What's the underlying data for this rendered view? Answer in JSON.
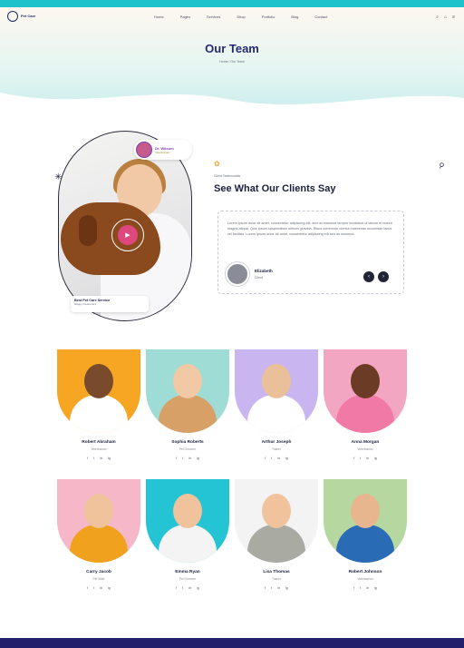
{
  "topbar": {
    "items": [
      "",
      "",
      "",
      "",
      "",
      "",
      ""
    ]
  },
  "header": {
    "logo_text": "Pet\nCare",
    "menu": [
      "Home",
      "Pages",
      "Services",
      "Shop",
      "Portfolio",
      "Blog",
      "Contact"
    ],
    "title": "Our Team",
    "breadcrumb": "Home / Our Team"
  },
  "hero_photo": {
    "doctor_name": "Dr. Wilsom",
    "doctor_role": "Veterinarian",
    "care_title": "Best Pet Care Service",
    "care_sub": "Happy Customers"
  },
  "testimonial": {
    "kicker": "Client Testimonials",
    "title": "See What Our Clients Say",
    "quote": "Lorem ipsum dolor sit amet, consectetur adipiscing elit, sed do eiusmod tempor incididunt ut labore et dolore magna aliqua. Quis ipsum suspendisse ultrices gravida. Risus commodo viverra maecenas accumsan lacus vel facilisis. Lorem ipsum dolor sit amet, consectetur adipiscing elit sed do eiusmod.",
    "author_name": "Elizabeth",
    "author_role": "Client",
    "prev": "‹",
    "next": "›"
  },
  "team": [
    {
      "name": "Robert Abraham",
      "role": "Veterinarian",
      "bg": "#f6a623",
      "skin": "#7a4a2c",
      "shirt": "#ffffff"
    },
    {
      "name": "Sophia Roberts",
      "role": "Pet Groomer",
      "bg": "#9fdcd5",
      "skin": "#f1c9a5",
      "shirt": "#d7a067"
    },
    {
      "name": "Arthur Joseph",
      "role": "Trainer",
      "bg": "#c9b6f0",
      "skin": "#eac09b",
      "shirt": "#ffffff"
    },
    {
      "name": "Anna Morgan",
      "role": "Veterinarian",
      "bg": "#f3a6c2",
      "skin": "#6b3b25",
      "shirt": "#f07aa5"
    },
    {
      "name": "Carry Jacob",
      "role": "Pet Sitter",
      "bg": "#f6b7c9",
      "skin": "#f0c39d",
      "shirt": "#f0a21f"
    },
    {
      "name": "Emma Ryan",
      "role": "Pet Groomer",
      "bg": "#25c4d4",
      "skin": "#f0c39d",
      "shirt": "#f4f4f4"
    },
    {
      "name": "Lisa Thomas",
      "role": "Trainer",
      "bg": "#f3f3f3",
      "skin": "#f0c39d",
      "shirt": "#a9aaa2"
    },
    {
      "name": "Robert Johnson",
      "role": "Veterinarian",
      "bg": "#b7d7a1",
      "skin": "#e7b68e",
      "shirt": "#2a6bb5"
    }
  ],
  "social_icons": [
    "f",
    "t",
    "in",
    "ig"
  ]
}
